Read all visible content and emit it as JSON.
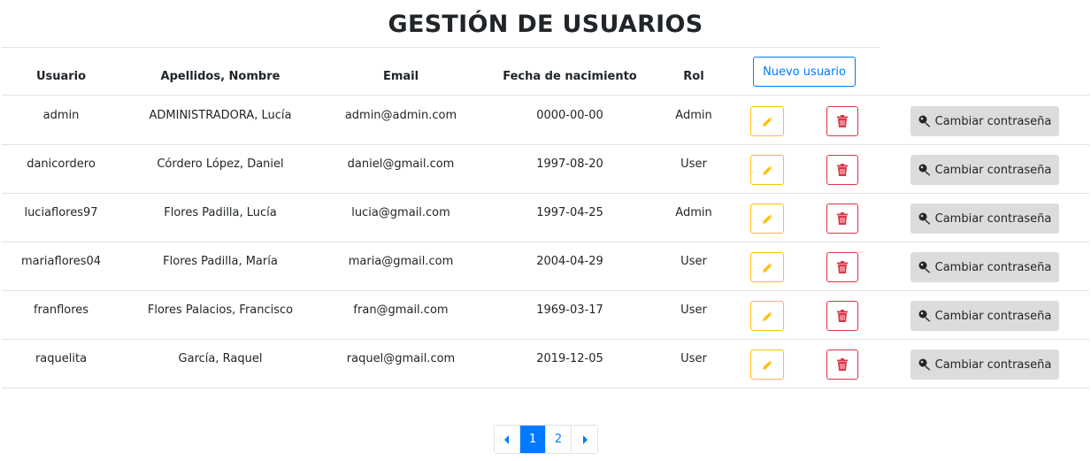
{
  "page": {
    "title": "GESTIÓN DE USUARIOS"
  },
  "table": {
    "headers": {
      "usuario": "Usuario",
      "nombre": "Apellidos, Nombre",
      "email": "Email",
      "fecha": "Fecha de nacimiento",
      "rol": "Rol"
    },
    "new_user_label": "Nuevo usuario",
    "change_password_label": "Cambiar contraseña",
    "rows": [
      {
        "usuario": "admin",
        "nombre": "ADMINISTRADORA, Lucía",
        "email": "admin@admin.com",
        "fecha": "0000-00-00",
        "rol": "Admin"
      },
      {
        "usuario": "danicordero",
        "nombre": "Córdero López, Daniel",
        "email": "daniel@gmail.com",
        "fecha": "1997-08-20",
        "rol": "User"
      },
      {
        "usuario": "luciaflores97",
        "nombre": "Flores Padilla, Lucía",
        "email": "lucia@gmail.com",
        "fecha": "1997-04-25",
        "rol": "Admin"
      },
      {
        "usuario": "mariaflores04",
        "nombre": "Flores Padilla, María",
        "email": "maria@gmail.com",
        "fecha": "2004-04-29",
        "rol": "User"
      },
      {
        "usuario": "franflores",
        "nombre": "Flores Palacios, Francisco",
        "email": "fran@gmail.com",
        "fecha": "1969-03-17",
        "rol": "User"
      },
      {
        "usuario": "raquelita",
        "nombre": "García, Raquel",
        "email": "raquel@gmail.com",
        "fecha": "2019-12-05",
        "rol": "User"
      }
    ]
  },
  "pagination": {
    "pages": [
      "1",
      "2"
    ],
    "active_page": "1"
  },
  "icons": {
    "edit": "pencil-icon",
    "delete": "trash-icon",
    "password": "key-icon",
    "prev": "caret-left-icon",
    "next": "caret-right-icon"
  },
  "colors": {
    "primary": "#007bff",
    "warning": "#ffc107",
    "danger": "#dc3545",
    "secondary_bg": "#dcdcdc"
  }
}
